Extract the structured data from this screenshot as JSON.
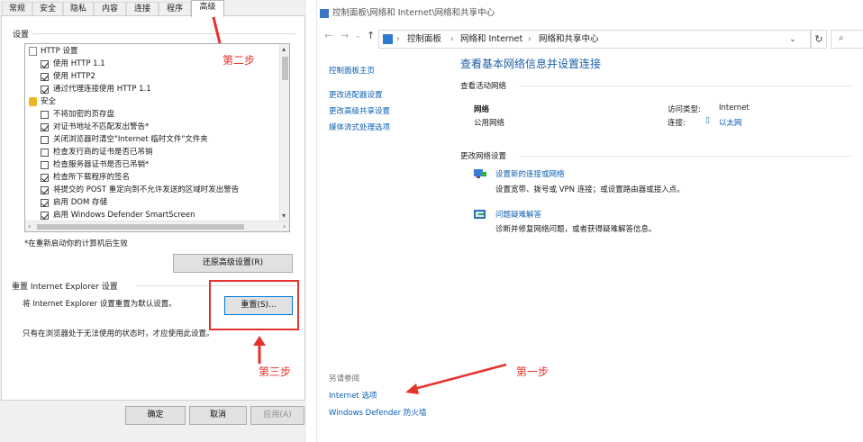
{
  "internet_options": {
    "tabs": [
      "常规",
      "安全",
      "隐私",
      "内容",
      "连接",
      "程序",
      "高级"
    ],
    "active_tab": "高级",
    "settings_label": "设置",
    "settings_items": [
      {
        "type": "group",
        "label": "HTTP 设置",
        "icon": "page-icon"
      },
      {
        "type": "check",
        "label": "使用 HTTP 1.1",
        "checked": true
      },
      {
        "type": "check",
        "label": "使用 HTTP2",
        "checked": true
      },
      {
        "type": "check",
        "label": "通过代理连接使用 HTTP 1.1",
        "checked": true
      },
      {
        "type": "group",
        "label": "安全",
        "icon": "lock-icon"
      },
      {
        "type": "check",
        "label": "不将加密的页存盘",
        "checked": false
      },
      {
        "type": "check",
        "label": "对证书地址不匹配发出警告*",
        "checked": true
      },
      {
        "type": "check",
        "label": "关闭浏览器时清空\"Internet 临时文件\"文件夹",
        "checked": false
      },
      {
        "type": "check",
        "label": "检查发行商的证书是否已吊销",
        "checked": false
      },
      {
        "type": "check",
        "label": "检查服务器证书是否已吊销*",
        "checked": false
      },
      {
        "type": "check",
        "label": "检查所下载程序的签名",
        "checked": true
      },
      {
        "type": "check",
        "label": "将提交的 POST 重定向到不允许发送的区域时发出警告",
        "checked": true
      },
      {
        "type": "check",
        "label": "启用 DOM 存储",
        "checked": true
      },
      {
        "type": "check",
        "label": "启用 Windows Defender SmartScreen",
        "checked": true
      }
    ],
    "restart_note": "*在重新启动你的计算机后生效",
    "restore_button": "还原高级设置(R)",
    "reset_group_label": "重置 Internet Explorer 设置",
    "reset_desc": "将 Internet Explorer 设置重置为默认设置。",
    "reset_button": "重置(S)...",
    "reset_note": "只有在浏览器处于无法使用的状态时，才应使用此设置。",
    "ok_button": "确定",
    "cancel_button": "取消",
    "apply_button": "应用(A)"
  },
  "annotations": {
    "step1": "第一步",
    "step2": "第二步",
    "step3": "第三步",
    "color": "#e5322c"
  },
  "network_center": {
    "window_title": "控制面板\\网络和 Internet\\网络和共享中心",
    "breadcrumb": [
      "控制面板",
      "网络和 Internet",
      "网络和共享中心"
    ],
    "sidebar_links": [
      "控制面板主页",
      "更改适配器设置",
      "更改高级共享设置",
      "媒体流式处理选项"
    ],
    "page_title": "查看基本网络信息并设置连接",
    "active_networks_label": "查看活动网络",
    "network_name": "网络",
    "network_type": "公用网络",
    "access_type_label": "访问类型:",
    "access_type_value": "Internet",
    "connections_label": "连接:",
    "connections_value": "以太网",
    "change_settings_label": "更改网络设置",
    "action1_title": "设置新的连接或网络",
    "action1_desc": "设置宽带、拨号或 VPN 连接；或设置路由器或接入点。",
    "action2_title": "问题疑难解答",
    "action2_desc": "诊断并修复网络问题，或者获得疑难解答信息。",
    "see_also_label": "另请参阅",
    "see_also_links": [
      "Internet 选项",
      "Windows Defender 防火墙"
    ],
    "accent_color": "#0b5fb3"
  }
}
